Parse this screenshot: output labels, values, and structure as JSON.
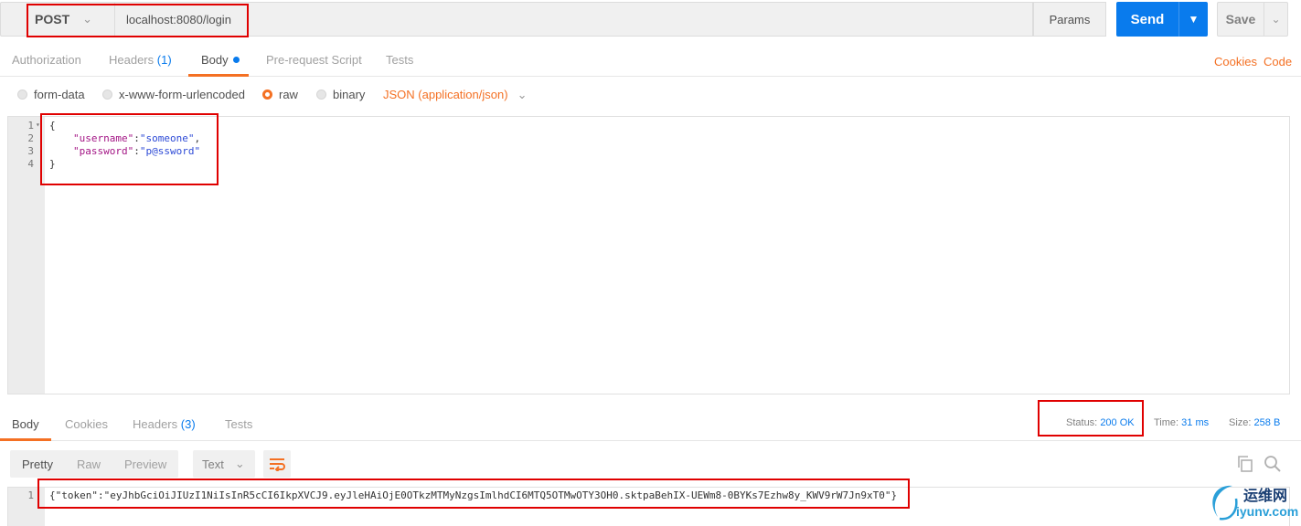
{
  "request": {
    "method": "POST",
    "url": "localhost:8080/login",
    "params_label": "Params",
    "send_label": "Send",
    "save_label": "Save"
  },
  "request_tabs": {
    "authorization": "Authorization",
    "headers": "Headers",
    "headers_count": "(1)",
    "body": "Body",
    "pre_request": "Pre-request Script",
    "tests": "Tests",
    "cookies": "Cookies",
    "code": "Code"
  },
  "body_modes": {
    "form_data": "form-data",
    "urlencoded": "x-www-form-urlencoded",
    "raw": "raw",
    "binary": "binary",
    "selected": "raw",
    "content_type": "JSON (application/json)"
  },
  "request_body": {
    "line_numbers": [
      "1",
      "2",
      "3",
      "4"
    ],
    "open_brace": "{",
    "username_key": "\"username\"",
    "username_value": "\"someone\"",
    "password_key": "\"password\"",
    "password_value": "\"p@ssword\"",
    "close_brace": "}"
  },
  "response_tabs": {
    "body": "Body",
    "cookies": "Cookies",
    "headers": "Headers",
    "headers_count": "(3)",
    "tests": "Tests"
  },
  "response_status": {
    "status_label": "Status:",
    "status_value": "200 OK",
    "time_label": "Time:",
    "time_value": "31 ms",
    "size_label": "Size:",
    "size_value": "258 B"
  },
  "response_view": {
    "pretty": "Pretty",
    "raw": "Raw",
    "preview": "Preview",
    "format": "Text"
  },
  "response_body": {
    "line_number": "1",
    "content": "{\"token\":\"eyJhbGciOiJIUzI1NiIsInR5cCI6IkpXVCJ9.eyJleHAiOjE0OTkzMTMyNzgsImlhdCI6MTQ5OTMwOTY3OH0.sktpaBehIX-UEWm8-0BYKs7Ezhw8y_KWV9rW7Jn9xT0\"}"
  },
  "watermark": {
    "cn": "运维网",
    "en": "iyunv.com"
  },
  "colors": {
    "accent_blue": "#097bed",
    "accent_orange": "#f47023",
    "highlight_red": "#e00000"
  }
}
